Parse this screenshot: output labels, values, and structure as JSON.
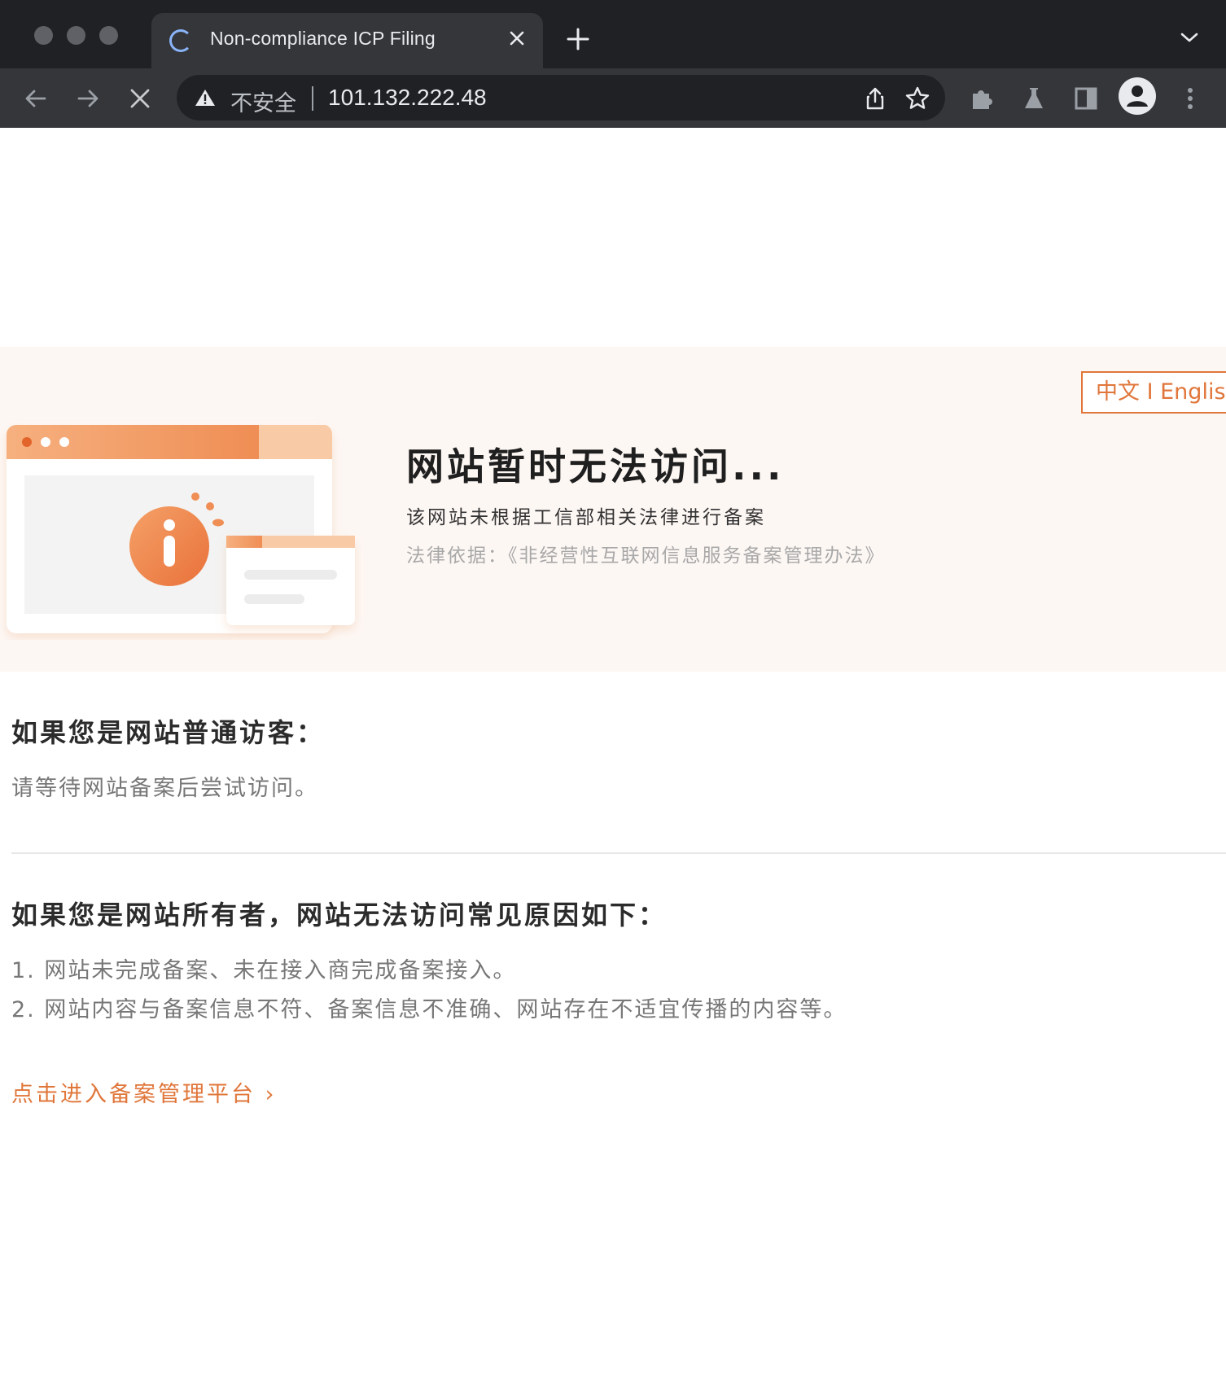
{
  "browser": {
    "tab_title": "Non-compliance ICP Filing",
    "security_label": "不安全",
    "url": "101.132.222.48"
  },
  "banner": {
    "lang_switch": "中文 I English",
    "heading": "网站暂时无法访问...",
    "subtitle": "该网站未根据工信部相关法律进行备案",
    "legal_basis": "法律依据：《非经营性互联网信息服务备案管理办法》"
  },
  "visitor": {
    "heading": "如果您是网站普通访客：",
    "text": "请等待网站备案后尝试访问。"
  },
  "owner": {
    "heading": "如果您是网站所有者，网站无法访问常见原因如下：",
    "reasons": [
      "1. 网站未完成备案、未在接入商完成备案接入。",
      "2. 网站内容与备案信息不符、备案信息不准确、网站存在不适宜传播的内容等。"
    ]
  },
  "link": {
    "label": "点击进入备案管理平台 ›"
  },
  "colors": {
    "accent": "#e0763a",
    "banner_bg": "#fdf7f4"
  }
}
